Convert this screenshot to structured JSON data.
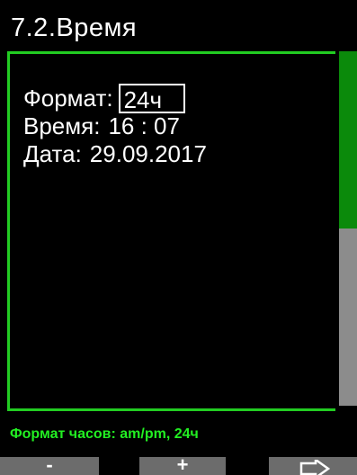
{
  "header": {
    "title": "7.2.Время"
  },
  "settings": {
    "format_label": "Формат:",
    "format_value": "24ч",
    "time_label": "Время:",
    "time_value": "16 : 07",
    "date_label": "Дата:",
    "date_value": "29.09.2017"
  },
  "scrollbar": {
    "position_fraction": 0.5
  },
  "status": {
    "hint": "Формат часов: am/pm, 24ч"
  },
  "softkeys": {
    "left_label": "-",
    "middle_label": "+",
    "right_icon": "right-arrow-icon"
  },
  "colors": {
    "accent_green": "#22cc22",
    "scroll_thumb": "#0b8a0b",
    "scroll_track": "#8c8c8c",
    "softkey_gray": "#6c6c6c",
    "background": "#000000"
  }
}
